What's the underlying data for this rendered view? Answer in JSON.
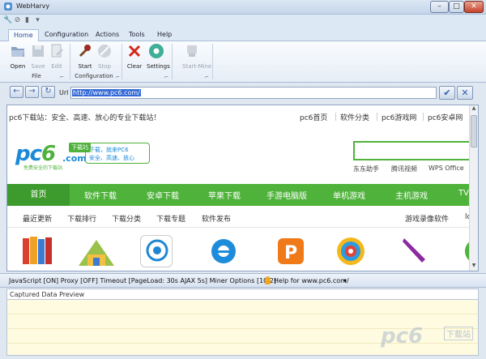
{
  "window": {
    "title": "WebHarvy"
  },
  "ribbon": {
    "tabs": [
      "Home",
      "Configuration",
      "Actions",
      "Tools",
      "Help"
    ],
    "active_tab": "Home",
    "file_group": {
      "label": "File",
      "buttons": [
        "Open",
        "Save",
        "Edit"
      ]
    },
    "config_group": {
      "label": "Configuration",
      "buttons": [
        "Start",
        "Stop"
      ]
    },
    "misc_group": {
      "buttons": [
        "Clear",
        "Settings"
      ]
    },
    "mine_group": {
      "buttons": [
        "Start-Mine"
      ]
    }
  },
  "addressbar": {
    "label": "Url",
    "url": "http://www.pc6.com/"
  },
  "page": {
    "slogan": "pc6下载站：安全、高速、放心的专业下载站！",
    "top_links": [
      "pc6首页",
      "软件分类",
      "pc6游戏网",
      "pc6安卓网"
    ],
    "logo": {
      "text_pc": "pc",
      "text_6": "6",
      "badge": "下载站",
      "com": ".com",
      "sub": "免费安全的下载站"
    },
    "bubble": [
      "下载，就来PC6",
      "安全、高速、放心"
    ],
    "search_keywords": [
      "东东助手",
      "腾讯视频",
      "WPS Office"
    ],
    "nav": [
      "首页",
      "软件下载",
      "安卓下载",
      "苹果下载",
      "手游电脑版",
      "单机游戏",
      "主机游戏",
      "TV"
    ],
    "subnav": [
      "最近更新",
      "下载排行",
      "下载分类",
      "下载专题",
      "软件发布"
    ],
    "subnav_right": [
      "游戏录像软件",
      "lo"
    ]
  },
  "statusbar": {
    "text": "JavaScript [ON]  Proxy [OFF]  Timeout [PageLoad: 30s  AJAX 5s]  Miner Options [10,2]",
    "help": "Help for www.pc6.com/"
  },
  "preview": {
    "header": "Captured Data Preview"
  },
  "watermark": {
    "text": "pc6",
    "tag": "下载站"
  },
  "colors": {
    "accent_green": "#4fb23b",
    "link_blue": "#1a8ad6",
    "ribbon_blue": "#1f4d96"
  }
}
